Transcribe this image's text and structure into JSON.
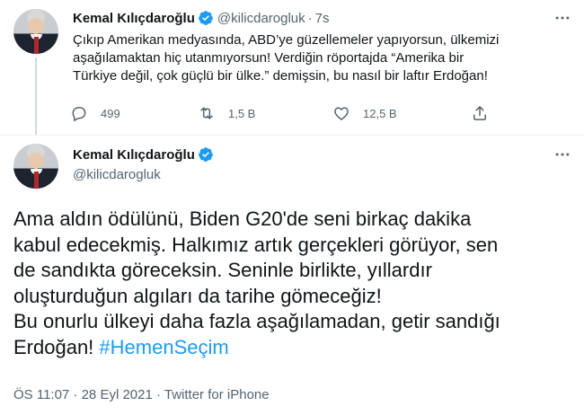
{
  "tweet1": {
    "name": "Kemal Kılıçdaroğlu",
    "handle": "@kilicdarogluk",
    "separator": "·",
    "time": "7s",
    "text_lines": [
      "Çıkıp Amerikan medyasında, ABD’ye güzellemeler yapıyorsun, ülkemizi",
      "aşağılamaktan hiç utanmıyorsun! Verdiğin röportajda “Amerika bir",
      "Türkiye değil, çok güçlü bir ülke.” demişsin, bu nasıl bir laftır Erdoğan!"
    ],
    "reply_count": "499",
    "retweet_count": "1,5 B",
    "like_count": "12,5 B"
  },
  "tweet2": {
    "name": "Kemal Kılıçdaroğlu",
    "handle": "@kilicdarogluk",
    "text_lines": [
      "Ama aldın ödülünü, Biden G20'de seni birkaç dakika",
      "kabul edecekmiş. Halkımız artık gerçekleri görüyor, sen",
      "de sandıkta göreceksin. Seninle birlikte, yıllardır",
      "oluşturduğun algıları da tarihe gömeceğiz!",
      "Bu onurlu ülkeyi daha fazla aşağılamadan, getir sandığı"
    ],
    "last_line_text": "Erdoğan!",
    "hashtag": "#HemenSeçim",
    "meta": "ÖS 11:07 · 28 Eyl 2021 · Twitter for iPhone"
  },
  "colors": {
    "accent": "#1d9bf0",
    "secondary_text": "#536471",
    "primary_text": "#0f1419",
    "divider": "#eff3f4"
  },
  "icons": [
    "verified-badge-icon",
    "more-icon",
    "reply-icon",
    "retweet-icon",
    "like-icon",
    "share-icon"
  ]
}
